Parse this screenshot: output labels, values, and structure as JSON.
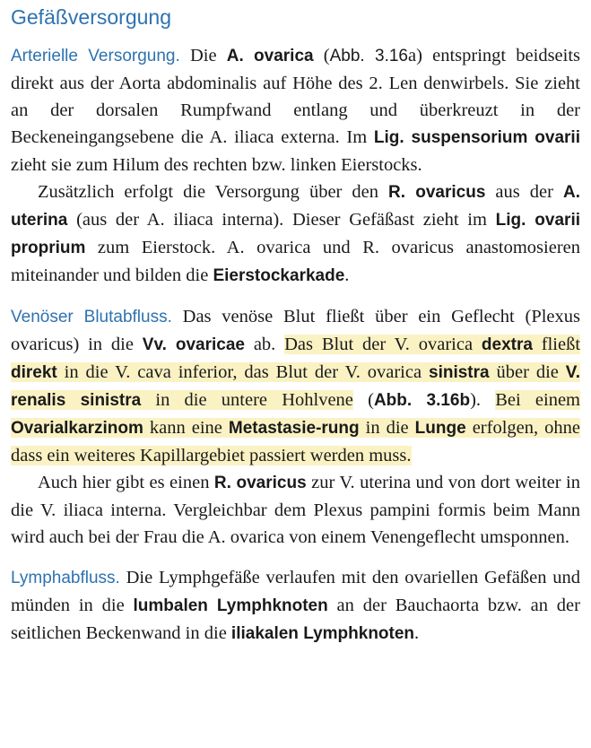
{
  "heading": "Gefäßversorgung",
  "arterial": {
    "lead": "Arterielle Versorgung.",
    "p1": [
      " Die ",
      "A. ovarica",
      " (",
      "Abb. 3.16",
      "a) entspringt beidseits direkt aus der Aorta abdominalis auf Höhe des 2. Len denwirbels. Sie zieht an der dorsalen Rumpfwand entlang und überkreuzt in der Beckeneingangsebene die A. iliaca externa. Im ",
      "Lig. suspensorium ovarii",
      " zieht sie zum Hilum des rechten bzw. linken Eierstocks."
    ],
    "p2": [
      "Zusätzlich erfolgt die Versorgung über den ",
      "R. ovaricus",
      " aus der ",
      "A. uterina",
      " (aus der A. iliaca interna). Dieser Gefäßast zieht im ",
      "Lig. ovarii proprium",
      " zum Eierstock. A. ovarica und R. ovaricus anastomosieren miteinander und bilden die ",
      "Eierstockarkade",
      "."
    ]
  },
  "venous": {
    "lead": "Venöser Blutabfluss.",
    "p1": [
      " Das venöse Blut fließt über ein Geflecht (Plexus ovaricus) in die ",
      "Vv. ovaricae",
      " ab. ",
      "Das Blut der V. ovarica ",
      "dextra",
      " fließt ",
      "direkt",
      " in die V. cava inferior, das Blut der V. ovarica ",
      "sinistra",
      " über die ",
      "V. renalis sinistra",
      " in die untere Hohlvene",
      " (",
      "Abb. 3.16b",
      "). ",
      "Bei einem ",
      "Ovarialkarzinom",
      " kann eine ",
      "Metastasie-rung",
      " in die ",
      "Lunge",
      " erfolgen, ohne dass ein weiteres Kapillargebiet passiert werden muss."
    ],
    "p2": [
      "Auch hier gibt es einen ",
      "R. ovaricus",
      " zur V. uterina und von dort weiter in die V. iliaca interna. Vergleichbar dem Plexus pampini formis beim Mann wird auch bei der Frau die A. ovarica von einem Venengeflecht umsponnen."
    ]
  },
  "lymph": {
    "lead": "Lymphabfluss.",
    "p1": [
      " Die Lymphgefäße verlaufen mit den ovariellen Gefäßen und münden in die ",
      "lumbalen Lymphknoten",
      " an der Bauchaorta bzw. an der seitlichen Beckenwand in die ",
      "iliakalen Lymphknoten",
      "."
    ]
  }
}
